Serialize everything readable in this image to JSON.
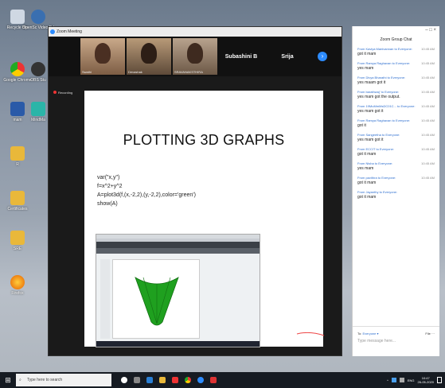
{
  "desktop": {
    "icons": [
      {
        "label": "Recycle Bin"
      },
      {
        "label": "OpenSc Video Ed"
      },
      {
        "label": "Google Chrome"
      },
      {
        "label": "OBS Stu"
      },
      {
        "label": "mam"
      },
      {
        "label": "MindMa"
      },
      {
        "label": "R"
      },
      {
        "label": "Certificates"
      },
      {
        "label": "SRE"
      },
      {
        "label": "Firefox"
      }
    ]
  },
  "zoom": {
    "window_title": "Zoom Meeting",
    "recording_label": "Recording",
    "participants": [
      {
        "name": "Swathi"
      },
      {
        "name": "Devashak"
      },
      {
        "name": "SRAVANAKSTHIRA"
      }
    ],
    "name_tiles": [
      "Subashini B",
      "Srija"
    ],
    "next_arrow": "›",
    "slide": {
      "title": "PLOTTING 3D GRAPHS",
      "code": [
        "var(\"x,y\")",
        "f=x^2+y^2",
        "A=plot3d(f,(x,-2,2),(y,-2,2),color='green')",
        "show(A)"
      ]
    }
  },
  "chat": {
    "title": "Zoom Group Chat",
    "window_controls": "–  □  ×",
    "messages": [
      {
        "from": "From Kaviya Manivannan to Everyone:",
        "time": "10:45 AM",
        "text": "got it mam"
      },
      {
        "from": "From Ramya Raghavan to Everyone:",
        "time": "10:45 AM",
        "text": "yes mam"
      },
      {
        "from": "From Divya Bharathi to Everyone:",
        "time": "10:45 AM",
        "text": "yes maam got it"
      },
      {
        "from": "From barathwaj' to Everyone:",
        "time": "10:45 AM",
        "text": "yes mam got the output."
      },
      {
        "from": "From 19MuMmMsDC01C... to Everyone:",
        "time": "10:45 AM",
        "text": "yes mam got it"
      },
      {
        "from": "From Ramya Raghavan to Everyone:",
        "time": "10:45 AM",
        "text": "got it"
      },
      {
        "from": "From Sangeetha to Everyone:",
        "time": "10:45 AM",
        "text": "yes mam got it"
      },
      {
        "from": "From ECCIT to Everyone:",
        "time": "10:45 AM",
        "text": "got it mam"
      },
      {
        "from": "From Nisha to Everyone:",
        "time": "10:45 AM",
        "text": "yes mam"
      },
      {
        "from": "From pavithra to Everyone:",
        "time": "10:45 AM",
        "text": "got it mam"
      },
      {
        "from": "From Jayanthy to Everyone:",
        "time": "",
        "text": "got it mam"
      }
    ],
    "to_label": "To:",
    "to_value": "Everyone ▾",
    "file_label": "File",
    "more": "···",
    "input_placeholder": "Type message here..."
  },
  "taskbar": {
    "search_placeholder": "Type here to search",
    "lang": "ENG",
    "time": "10:47",
    "date": "26-05-2020"
  },
  "colors": {
    "accent": "#2d8cff",
    "plot_green": "#1fa01f"
  }
}
